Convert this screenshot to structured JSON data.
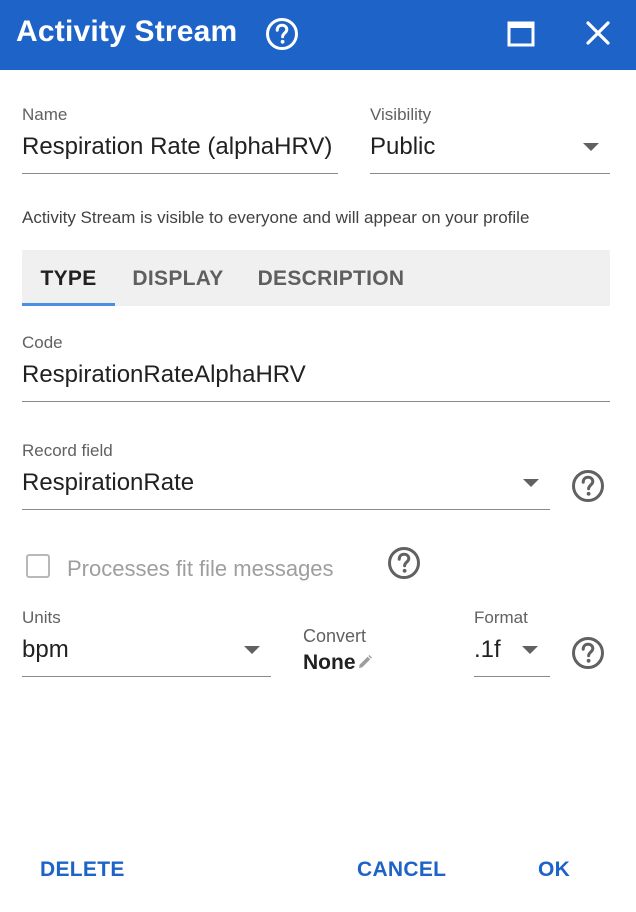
{
  "dialog": {
    "title": "Activity Stream",
    "icons": {
      "help": "help-circle-icon",
      "maximize": "maximize-icon",
      "close": "close-icon"
    }
  },
  "fields": {
    "name": {
      "label": "Name",
      "value": "Respiration Rate (alphaHRV)"
    },
    "visibility": {
      "label": "Visibility",
      "value": "Public"
    }
  },
  "info_text": "Activity Stream is visible to everyone and will appear on your profile",
  "tabs": [
    {
      "label": "TYPE",
      "active": true
    },
    {
      "label": "DISPLAY",
      "active": false
    },
    {
      "label": "DESCRIPTION",
      "active": false
    }
  ],
  "type_tab": {
    "code": {
      "label": "Code",
      "value": "RespirationRateAlphaHRV"
    },
    "record_field": {
      "label": "Record field",
      "value": "RespirationRate"
    },
    "processes_fit": {
      "label": "Processes fit file messages",
      "checked": false
    },
    "units": {
      "label": "Units",
      "value": "bpm"
    },
    "convert": {
      "label": "Convert",
      "value": "None"
    },
    "format": {
      "label": "Format",
      "value": ".1f"
    }
  },
  "actions": {
    "delete": "DELETE",
    "cancel": "CANCEL",
    "ok": "OK"
  },
  "colors": {
    "primary": "#1e63c8",
    "tab_indicator": "#4a90e2",
    "tab_background": "#f0f0f0"
  }
}
